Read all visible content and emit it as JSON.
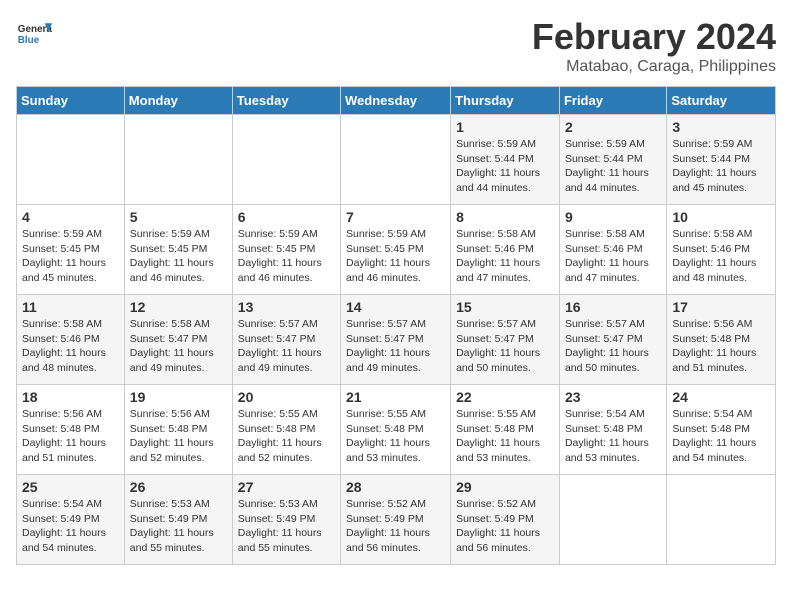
{
  "header": {
    "logo_line1": "General",
    "logo_line2": "Blue",
    "title": "February 2024",
    "subtitle": "Matabao, Caraga, Philippines"
  },
  "days_of_week": [
    "Sunday",
    "Monday",
    "Tuesday",
    "Wednesday",
    "Thursday",
    "Friday",
    "Saturday"
  ],
  "weeks": [
    [
      {
        "day": "",
        "info": ""
      },
      {
        "day": "",
        "info": ""
      },
      {
        "day": "",
        "info": ""
      },
      {
        "day": "",
        "info": ""
      },
      {
        "day": "1",
        "info": "Sunrise: 5:59 AM\nSunset: 5:44 PM\nDaylight: 11 hours\nand 44 minutes."
      },
      {
        "day": "2",
        "info": "Sunrise: 5:59 AM\nSunset: 5:44 PM\nDaylight: 11 hours\nand 44 minutes."
      },
      {
        "day": "3",
        "info": "Sunrise: 5:59 AM\nSunset: 5:44 PM\nDaylight: 11 hours\nand 45 minutes."
      }
    ],
    [
      {
        "day": "4",
        "info": "Sunrise: 5:59 AM\nSunset: 5:45 PM\nDaylight: 11 hours\nand 45 minutes."
      },
      {
        "day": "5",
        "info": "Sunrise: 5:59 AM\nSunset: 5:45 PM\nDaylight: 11 hours\nand 46 minutes."
      },
      {
        "day": "6",
        "info": "Sunrise: 5:59 AM\nSunset: 5:45 PM\nDaylight: 11 hours\nand 46 minutes."
      },
      {
        "day": "7",
        "info": "Sunrise: 5:59 AM\nSunset: 5:45 PM\nDaylight: 11 hours\nand 46 minutes."
      },
      {
        "day": "8",
        "info": "Sunrise: 5:58 AM\nSunset: 5:46 PM\nDaylight: 11 hours\nand 47 minutes."
      },
      {
        "day": "9",
        "info": "Sunrise: 5:58 AM\nSunset: 5:46 PM\nDaylight: 11 hours\nand 47 minutes."
      },
      {
        "day": "10",
        "info": "Sunrise: 5:58 AM\nSunset: 5:46 PM\nDaylight: 11 hours\nand 48 minutes."
      }
    ],
    [
      {
        "day": "11",
        "info": "Sunrise: 5:58 AM\nSunset: 5:46 PM\nDaylight: 11 hours\nand 48 minutes."
      },
      {
        "day": "12",
        "info": "Sunrise: 5:58 AM\nSunset: 5:47 PM\nDaylight: 11 hours\nand 49 minutes."
      },
      {
        "day": "13",
        "info": "Sunrise: 5:57 AM\nSunset: 5:47 PM\nDaylight: 11 hours\nand 49 minutes."
      },
      {
        "day": "14",
        "info": "Sunrise: 5:57 AM\nSunset: 5:47 PM\nDaylight: 11 hours\nand 49 minutes."
      },
      {
        "day": "15",
        "info": "Sunrise: 5:57 AM\nSunset: 5:47 PM\nDaylight: 11 hours\nand 50 minutes."
      },
      {
        "day": "16",
        "info": "Sunrise: 5:57 AM\nSunset: 5:47 PM\nDaylight: 11 hours\nand 50 minutes."
      },
      {
        "day": "17",
        "info": "Sunrise: 5:56 AM\nSunset: 5:48 PM\nDaylight: 11 hours\nand 51 minutes."
      }
    ],
    [
      {
        "day": "18",
        "info": "Sunrise: 5:56 AM\nSunset: 5:48 PM\nDaylight: 11 hours\nand 51 minutes."
      },
      {
        "day": "19",
        "info": "Sunrise: 5:56 AM\nSunset: 5:48 PM\nDaylight: 11 hours\nand 52 minutes."
      },
      {
        "day": "20",
        "info": "Sunrise: 5:55 AM\nSunset: 5:48 PM\nDaylight: 11 hours\nand 52 minutes."
      },
      {
        "day": "21",
        "info": "Sunrise: 5:55 AM\nSunset: 5:48 PM\nDaylight: 11 hours\nand 53 minutes."
      },
      {
        "day": "22",
        "info": "Sunrise: 5:55 AM\nSunset: 5:48 PM\nDaylight: 11 hours\nand 53 minutes."
      },
      {
        "day": "23",
        "info": "Sunrise: 5:54 AM\nSunset: 5:48 PM\nDaylight: 11 hours\nand 53 minutes."
      },
      {
        "day": "24",
        "info": "Sunrise: 5:54 AM\nSunset: 5:48 PM\nDaylight: 11 hours\nand 54 minutes."
      }
    ],
    [
      {
        "day": "25",
        "info": "Sunrise: 5:54 AM\nSunset: 5:49 PM\nDaylight: 11 hours\nand 54 minutes."
      },
      {
        "day": "26",
        "info": "Sunrise: 5:53 AM\nSunset: 5:49 PM\nDaylight: 11 hours\nand 55 minutes."
      },
      {
        "day": "27",
        "info": "Sunrise: 5:53 AM\nSunset: 5:49 PM\nDaylight: 11 hours\nand 55 minutes."
      },
      {
        "day": "28",
        "info": "Sunrise: 5:52 AM\nSunset: 5:49 PM\nDaylight: 11 hours\nand 56 minutes."
      },
      {
        "day": "29",
        "info": "Sunrise: 5:52 AM\nSunset: 5:49 PM\nDaylight: 11 hours\nand 56 minutes."
      },
      {
        "day": "",
        "info": ""
      },
      {
        "day": "",
        "info": ""
      }
    ]
  ]
}
